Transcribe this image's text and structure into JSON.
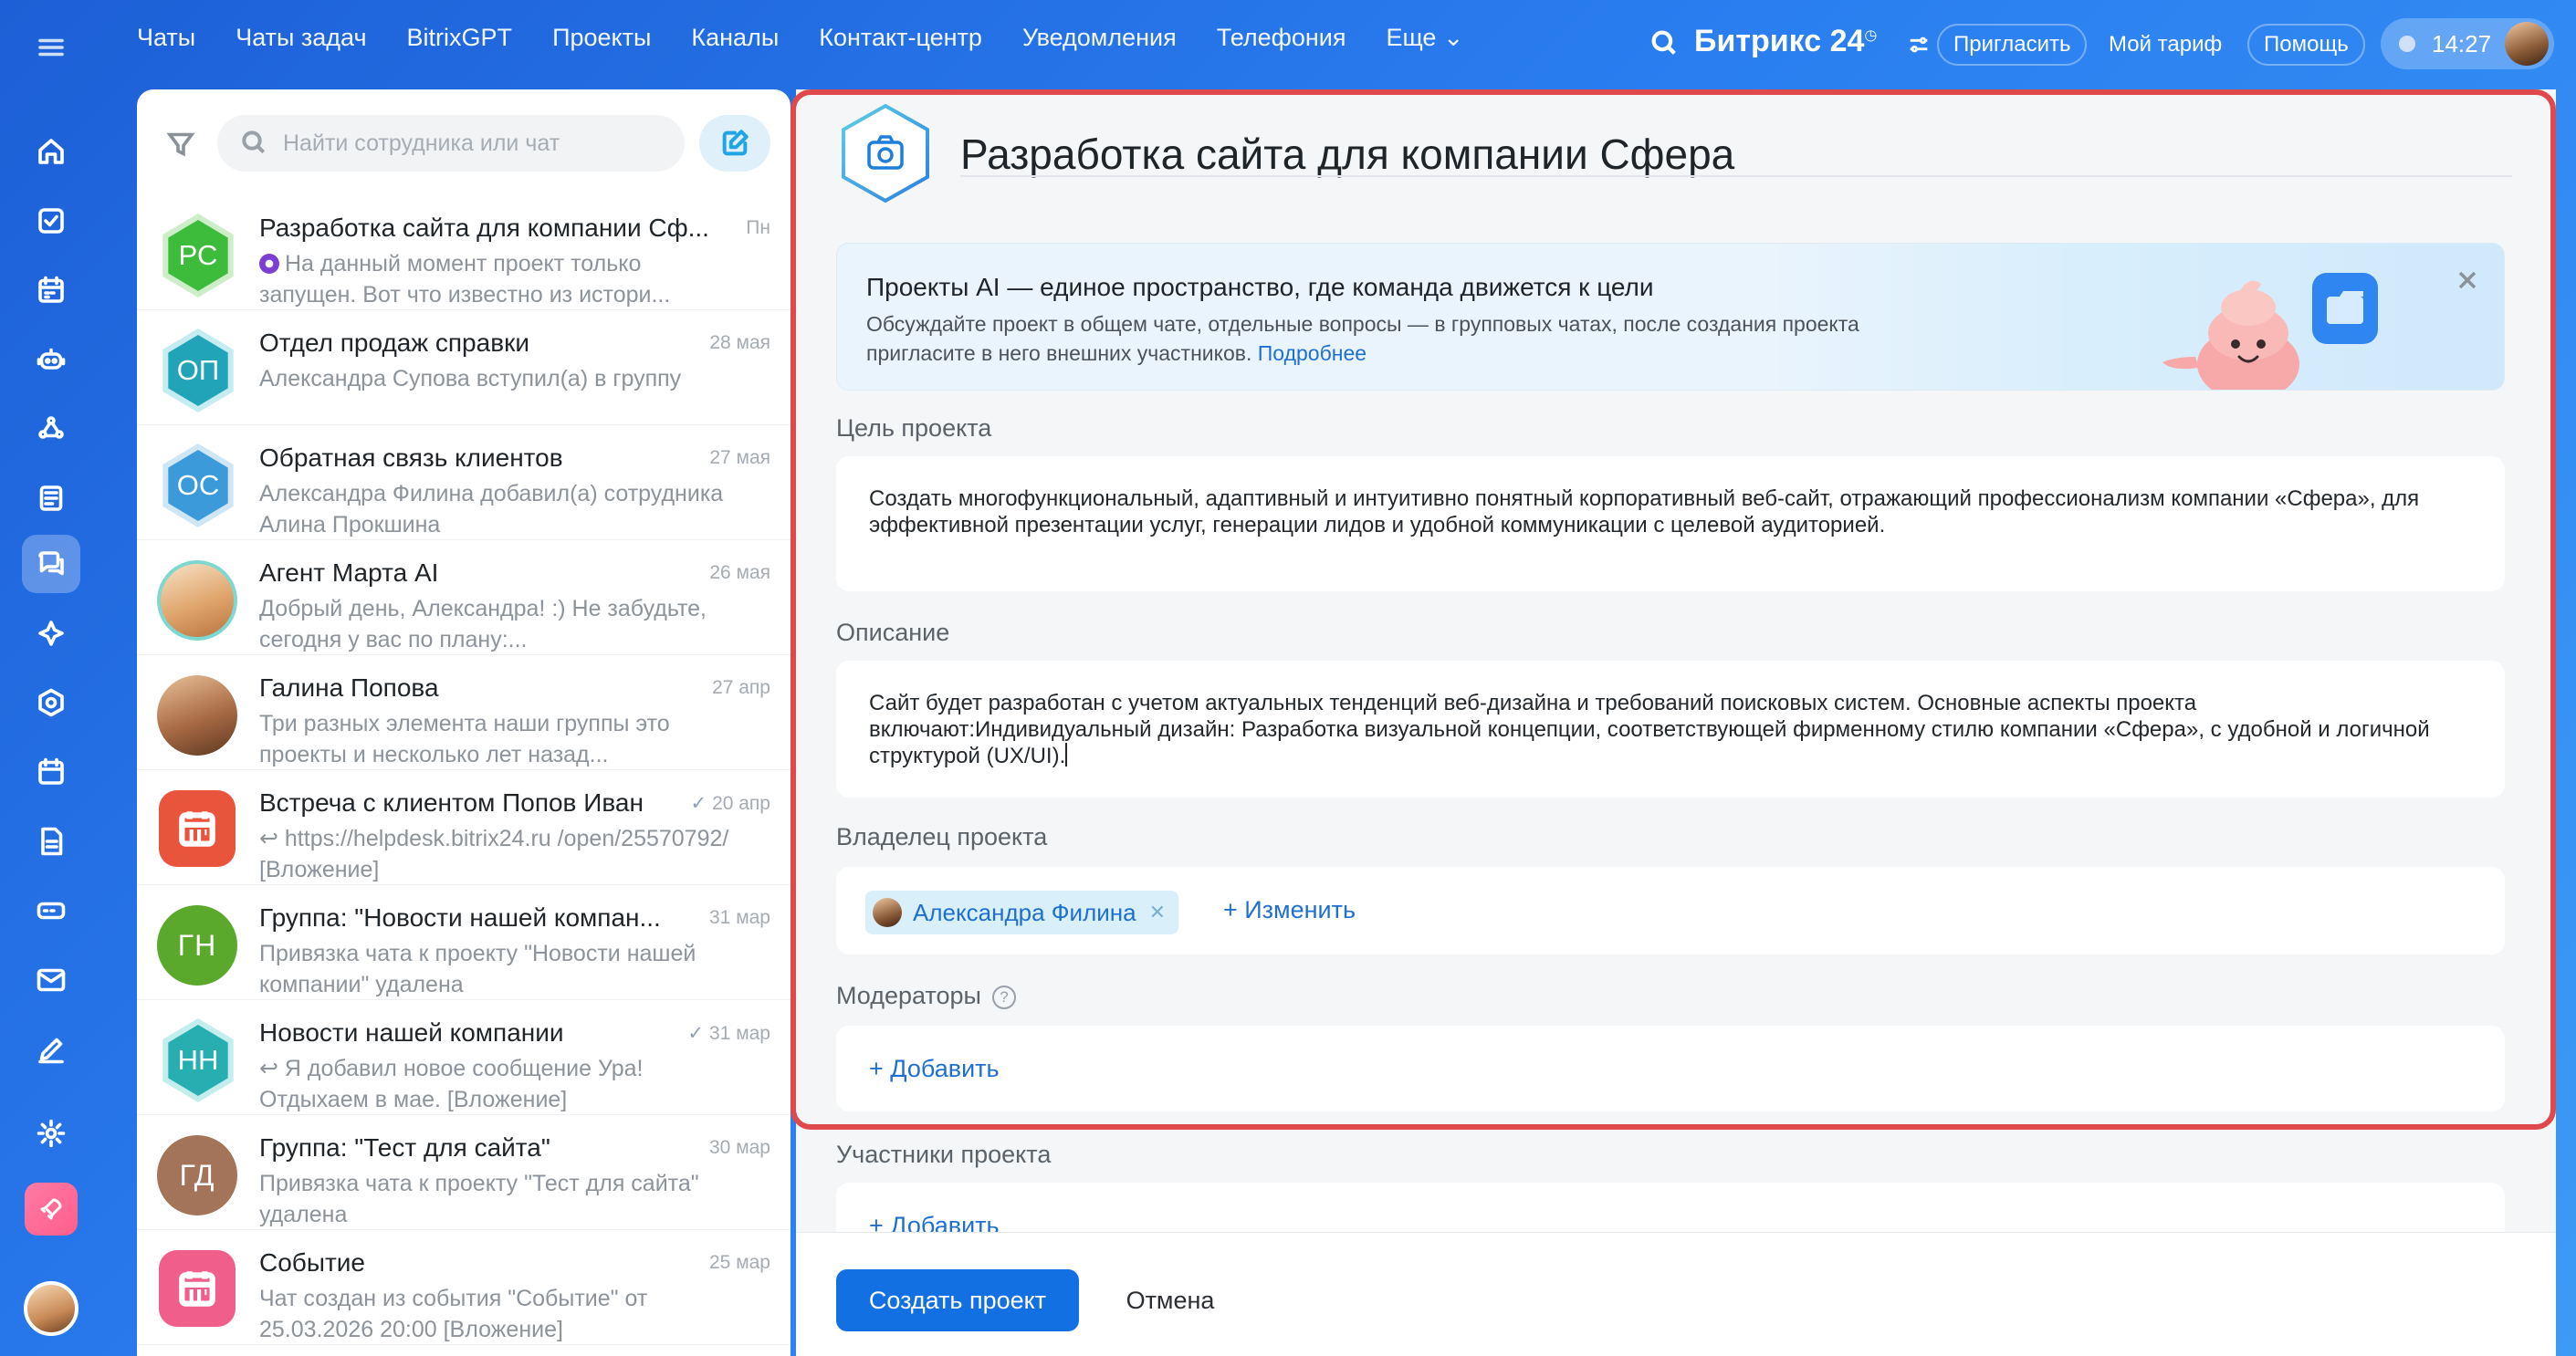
{
  "topnav": {
    "items": [
      "Чаты",
      "Чаты задач",
      "BitrixGPT",
      "Проекты",
      "Каналы",
      "Контакт-центр",
      "Уведомления",
      "Телефония",
      "Еще ⌄"
    ],
    "brand": "Битрикс 24",
    "brand_mark": "◷",
    "invite": "Пригласить",
    "tariff": "Мой тариф",
    "help": "Помощь",
    "time": "14:27"
  },
  "chats": {
    "search_placeholder": "Найти сотрудника или чат",
    "items": [
      {
        "initials": "РС",
        "title": "Разработка сайта для компании Сф...",
        "date": "Пн",
        "preview": "На данный момент проект только запущен. Вот что известно из истори...",
        "color": "#3dbb3b"
      },
      {
        "initials": "ОП",
        "title": "Отдел продаж справки",
        "date": "28 мая",
        "preview": "Александра Супова вступил(а) в группу",
        "color": "#21a3b8"
      },
      {
        "initials": "ОС",
        "title": "Обратная связь клиентов",
        "date": "27 мая",
        "preview": "Александра Филина добавил(а) сотрудника Алина Прокшина",
        "color": "#3b9ad9"
      },
      {
        "initials": "",
        "title": "Агент Марта AI",
        "date": "26 мая",
        "preview": "Добрый день, Александра! :) Не забудьте, сегодня у вас по плану:...",
        "color": "#e9c3a0"
      },
      {
        "initials": "",
        "title": "Галина Попова",
        "date": "27 апр",
        "preview": "Три разных элемента наши группы это проекты и несколько лет назад...",
        "color": "#b57a52"
      },
      {
        "initials": "",
        "title": "Встреча с клиентом Попов Иван",
        "date": "20 апр",
        "preview": "↩ https://helpdesk.bitrix24.ru /open/25570792/ [Вложение]",
        "color": "#e8543c"
      },
      {
        "initials": "ГН",
        "title": "Группа: \"Новости нашей компан...",
        "date": "31 мар",
        "preview": "Привязка чата к проекту \"Новости нашей компании\" удалена",
        "color": "#5aa82c"
      },
      {
        "initials": "НН",
        "title": "Новости нашей компании",
        "date": "31 мар",
        "preview": "↩ Я добавил новое сообщение Ура! Отдыхаем в мае. [Вложение]",
        "color": "#27aeb0"
      },
      {
        "initials": "ГД",
        "title": "Группа: \"Тест для сайта\"",
        "date": "30 мар",
        "preview": "Привязка чата к проекту \"Тест для сайта\" удалена",
        "color": "#a37459"
      },
      {
        "initials": "",
        "title": "Событие",
        "date": "25 мар",
        "preview": "Чат создан из события \"Событие\" от 25.03.2026 20:00 [Вложение]",
        "color": "#f05f8c"
      }
    ]
  },
  "project": {
    "title": "Разработка сайта для компании Сфера",
    "banner": {
      "title": "Проекты AI — единое пространство, где команда движется к цели",
      "text": "Обсуждайте проект в общем чате, отдельные вопросы — в групповых чатах, после создания проекта пригласите в него внешних участников.",
      "link": "Подробнее"
    },
    "goal_label": "Цель проекта",
    "goal_text": "Создать многофункциональный, адаптивный и интуитивно понятный корпоративный веб-сайт, отражающий профессионализм компании «Сфера», для эффективной презентации услуг, генерации лидов и удобной коммуникации с целевой аудиторией.",
    "description_label": "Описание",
    "description_text": "Сайт будет разработан с учетом актуальных тенденций веб-дизайна и требований поисковых систем. Основные аспекты проекта включают:Индивидуальный дизайн: Разработка визуальной концепции, соответствующей фирменному стилю компании «Сфера», с удобной и логичной структурой (UX/UI).",
    "owner_label": "Владелец проекта",
    "owner_name": "Александра Филина",
    "owner_change": "+ Изменить",
    "moderators_label": "Модераторы",
    "moderators_add": "+ Добавить",
    "members_label": "Участники проекта",
    "members_add": "+ Добавить",
    "create_button": "Создать проект",
    "cancel_button": "Отмена"
  },
  "colors": {
    "accent": "#1270e3",
    "highlight": "#e0494b",
    "link": "#1f6fd1"
  }
}
